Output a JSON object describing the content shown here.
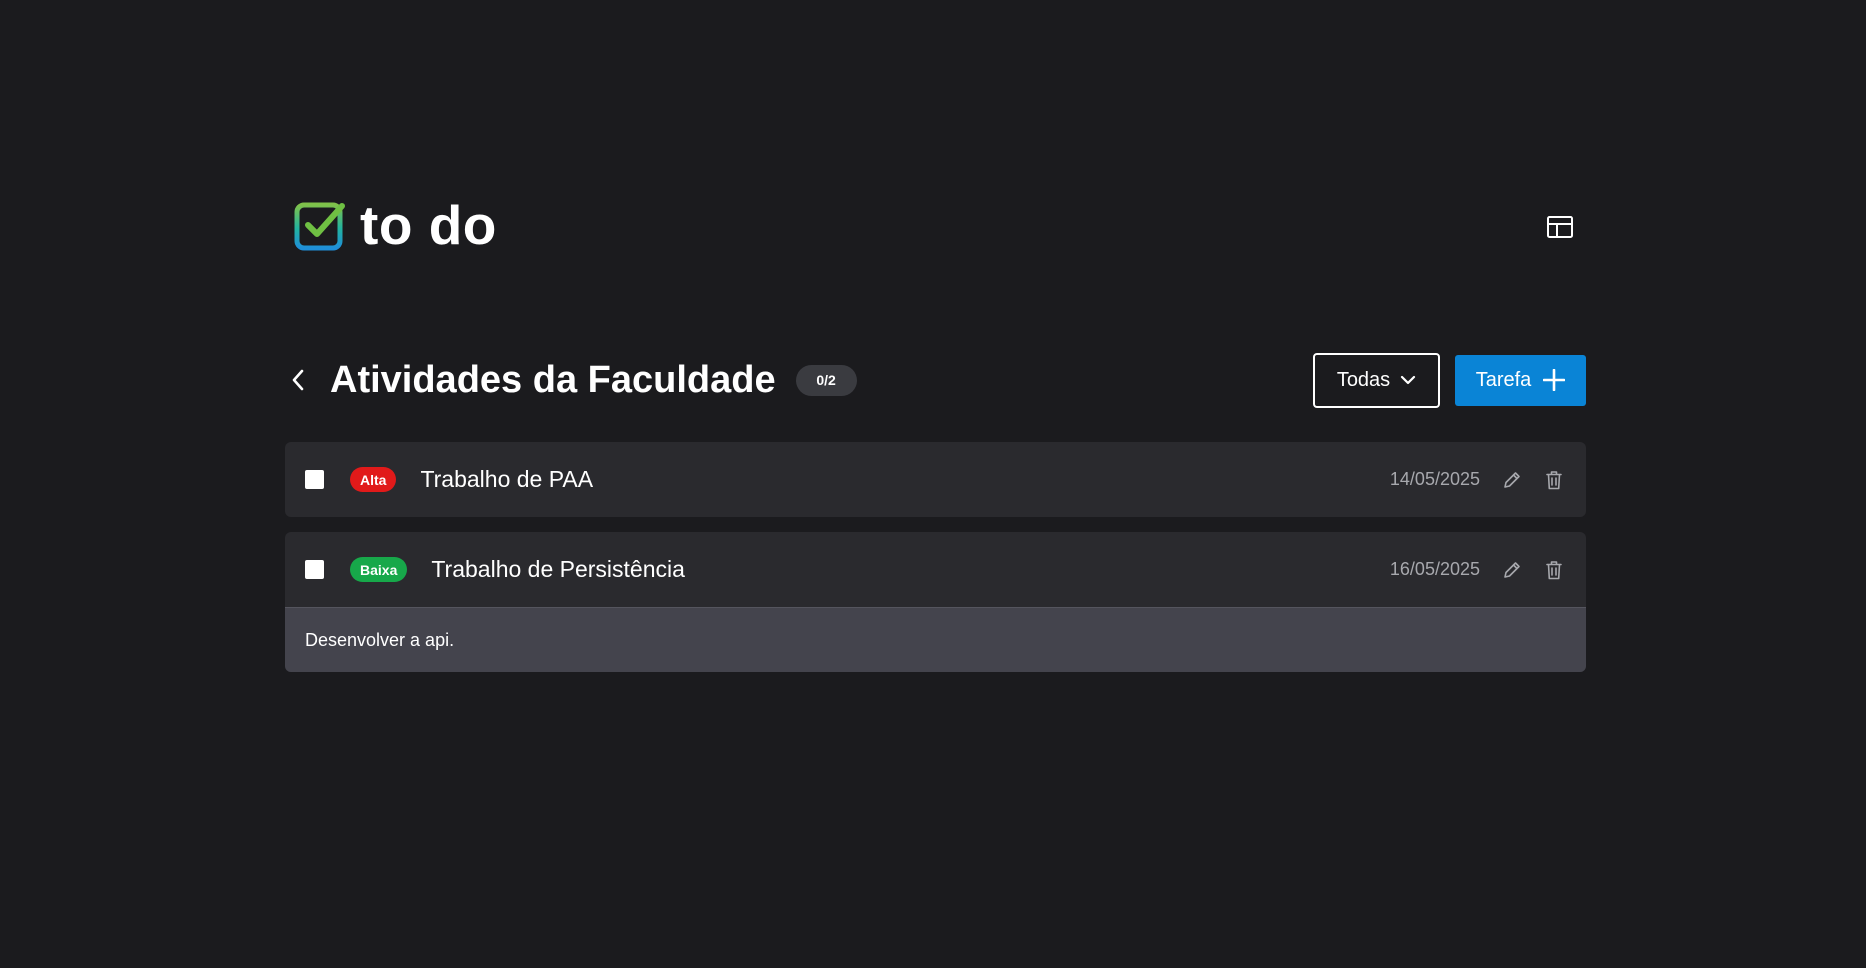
{
  "app": {
    "name": "to do"
  },
  "list": {
    "title": "Atividades da Faculdade",
    "count": "0/2"
  },
  "filter": {
    "selected": "Todas"
  },
  "add_button": {
    "label": "Tarefa"
  },
  "icons": {
    "logo": "checkbox-check-icon",
    "layout": "layout-panel-icon",
    "back": "chevron-left-icon",
    "dropdown": "chevron-down-icon",
    "add": "plus-icon",
    "edit": "pencil-icon",
    "delete": "trash-icon"
  },
  "colors": {
    "background": "#1b1b1e",
    "card": "#2a2a2e",
    "description_bg": "#44444d",
    "accent": "#0a84d6",
    "priority_alta": "#e11a1a",
    "priority_baixa": "#17a84a"
  },
  "tasks": [
    {
      "checked": false,
      "priority": "Alta",
      "name": "Trabalho de PAA",
      "date": "14/05/2025",
      "description": ""
    },
    {
      "checked": false,
      "priority": "Baixa",
      "name": "Trabalho de Persistência",
      "date": "16/05/2025",
      "description": "Desenvolver a api."
    }
  ]
}
